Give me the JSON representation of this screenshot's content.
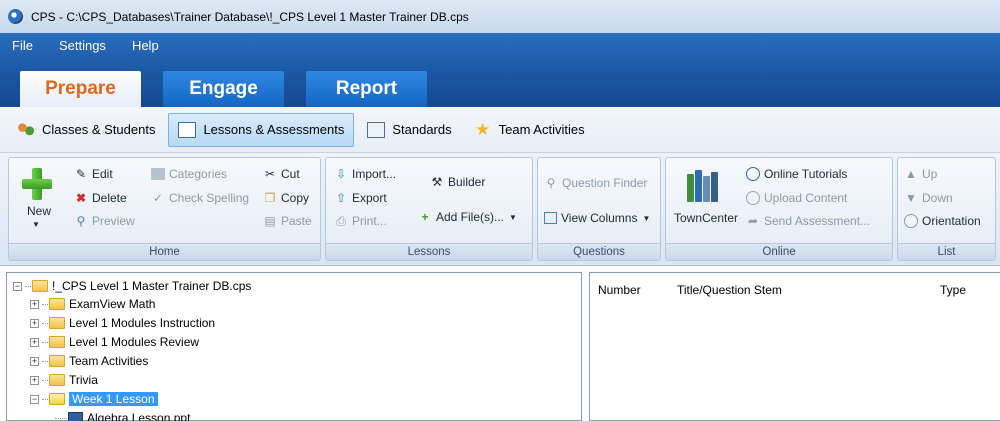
{
  "window": {
    "title": "CPS - C:\\CPS_Databases\\Trainer Database\\!_CPS Level 1 Master Trainer DB.cps"
  },
  "menu": [
    "File",
    "Settings",
    "Help"
  ],
  "mode_tabs": [
    "Prepare",
    "Engage",
    "Report"
  ],
  "sub_tabs": [
    "Classes & Students",
    "Lessons & Assessments",
    "Standards",
    "Team Activities"
  ],
  "ribbon": {
    "home": {
      "label": "Home",
      "new": "New",
      "edit": "Edit",
      "delete": "Delete",
      "preview": "Preview",
      "categories": "Categories",
      "check_spelling": "Check Spelling",
      "cut": "Cut",
      "copy": "Copy",
      "paste": "Paste"
    },
    "lessons": {
      "label": "Lessons",
      "import": "Import...",
      "export": "Export",
      "print": "Print...",
      "builder": "Builder",
      "add_files": "Add File(s)..."
    },
    "questions": {
      "label": "Questions",
      "question_finder": "Question Finder",
      "view_columns": "View Columns"
    },
    "online": {
      "label": "Online",
      "towncenter": "TownCenter",
      "online_tutorials": "Online Tutorials",
      "upload_content": "Upload Content",
      "send_assessment": "Send Assessment..."
    },
    "list": {
      "label": "List",
      "up": "Up",
      "down": "Down",
      "orientation": "Orientation"
    }
  },
  "tree": {
    "root": "!_CPS Level 1 Master Trainer DB.cps",
    "items": [
      "ExamView Math",
      "Level 1 Modules Instruction",
      "Level 1 Modules Review",
      "Team Activities",
      "Trivia",
      "Week 1 Lesson"
    ],
    "child": "Algebra Lesson.ppt"
  },
  "columns": [
    "Number",
    "Title/Question Stem",
    "Type"
  ],
  "colors": {
    "prepare_text": "#e2671c",
    "band_blue": "#1d5aa8",
    "selection": "#3399ff"
  }
}
